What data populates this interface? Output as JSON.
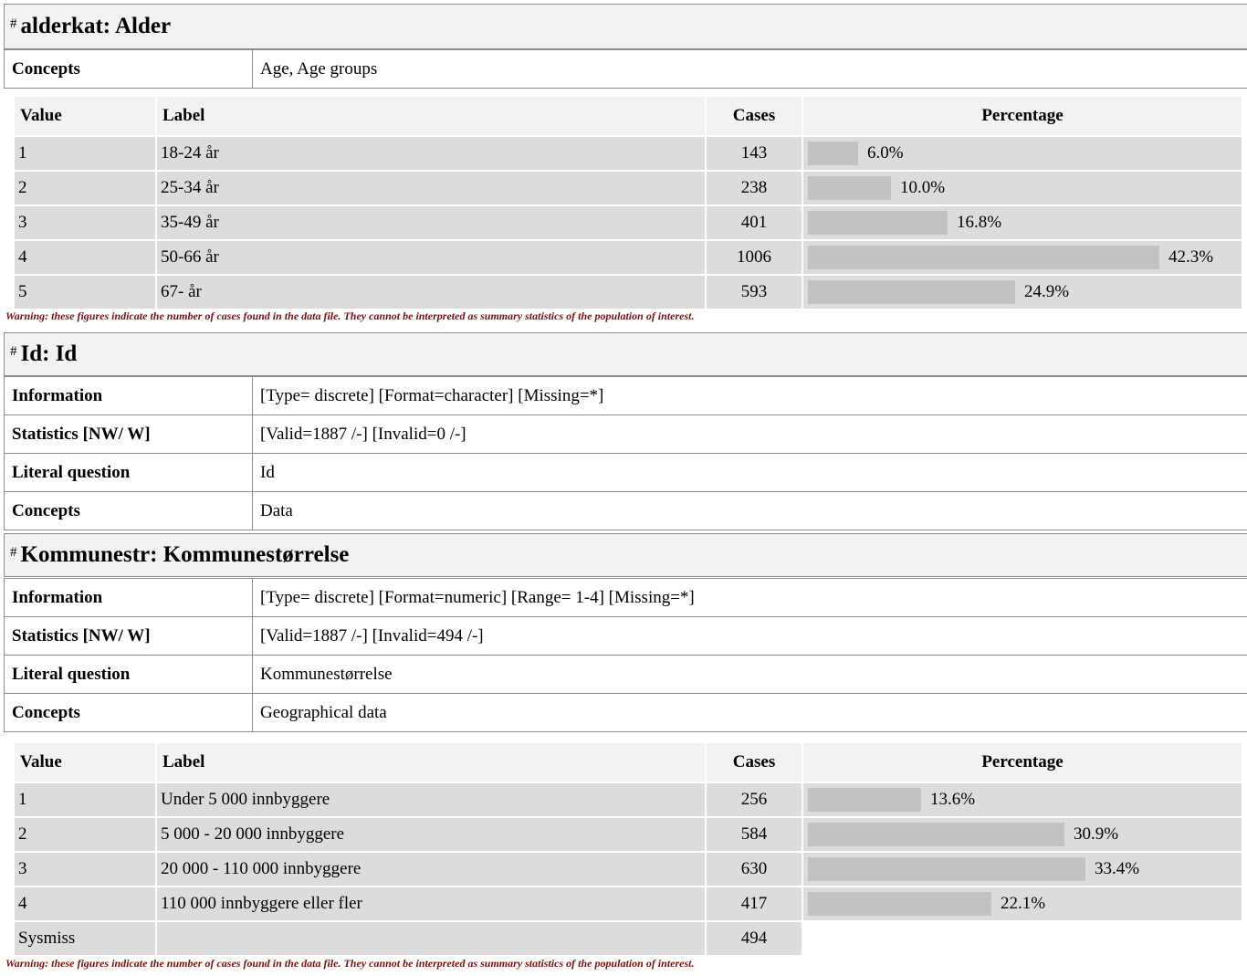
{
  "alderkat": {
    "title": "alderkat: Alder",
    "concepts_label": "Concepts",
    "concepts_value": "Age, Age groups",
    "table_headers": {
      "value": "Value",
      "label": "Label",
      "cases": "Cases",
      "percentage": "Percentage"
    },
    "rows": [
      {
        "value": "1",
        "label": "18-24 år",
        "cases": "143",
        "pct": "6.0%",
        "pct_num": 6.0
      },
      {
        "value": "2",
        "label": "25-34 år",
        "cases": "238",
        "pct": "10.0%",
        "pct_num": 10.0
      },
      {
        "value": "3",
        "label": "35-49 år",
        "cases": "401",
        "pct": "16.8%",
        "pct_num": 16.8
      },
      {
        "value": "4",
        "label": "50-66 år",
        "cases": "1006",
        "pct": "42.3%",
        "pct_num": 42.3
      },
      {
        "value": "5",
        "label": "67- år",
        "cases": "593",
        "pct": "24.9%",
        "pct_num": 24.9
      }
    ],
    "warning": "Warning: these figures indicate the number of cases found in the data file. They cannot be interpreted as summary statistics of the population of interest."
  },
  "id": {
    "title": "Id: Id",
    "info_label": "Information",
    "info_value": "[Type= discrete] [Format=character] [Missing=*]",
    "stats_label": "Statistics [NW/ W]",
    "stats_value": "[Valid=1887 /-] [Invalid=0 /-]",
    "question_label": "Literal question",
    "question_value": "Id",
    "concepts_label": "Concepts",
    "concepts_value": "Data"
  },
  "kommunestr": {
    "title": "Kommunestr: Kommunestørrelse",
    "info_label": "Information",
    "info_value": "[Type= discrete] [Format=numeric] [Range= 1-4] [Missing=*]",
    "stats_label": "Statistics [NW/ W]",
    "stats_value": "[Valid=1887 /-] [Invalid=494 /-]",
    "question_label": "Literal question",
    "question_value": "Kommunestørrelse",
    "concepts_label": "Concepts",
    "concepts_value": "Geographical data",
    "table_headers": {
      "value": "Value",
      "label": "Label",
      "cases": "Cases",
      "percentage": "Percentage"
    },
    "rows": [
      {
        "value": "1",
        "label": "Under 5 000 innbyggere",
        "cases": "256",
        "pct": "13.6%",
        "pct_num": 13.6
      },
      {
        "value": "2",
        "label": "5 000 - 20 000 innbyggere",
        "cases": "584",
        "pct": "30.9%",
        "pct_num": 30.9
      },
      {
        "value": "3",
        "label": "20 000 - 110 000 innbyggere",
        "cases": "630",
        "pct": "33.4%",
        "pct_num": 33.4
      },
      {
        "value": "4",
        "label": "110 000 innbyggere eller fler",
        "cases": "417",
        "pct": "22.1%",
        "pct_num": 22.1
      }
    ],
    "sysmiss": {
      "value": "Sysmiss",
      "cases": "494"
    },
    "warning": "Warning: these figures indicate the number of cases found in the data file. They cannot be interpreted as summary statistics of the population of interest."
  }
}
